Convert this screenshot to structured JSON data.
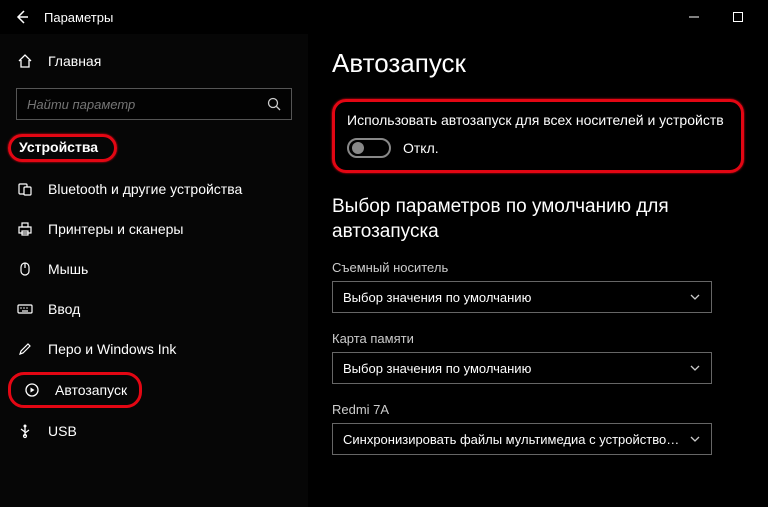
{
  "window": {
    "title": "Параметры"
  },
  "sidebar": {
    "home_label": "Главная",
    "search_placeholder": "Найти параметр",
    "section_header": "Устройства",
    "items": [
      {
        "label": "Bluetooth и другие устройства"
      },
      {
        "label": "Принтеры и сканеры"
      },
      {
        "label": "Мышь"
      },
      {
        "label": "Ввод"
      },
      {
        "label": "Перо и Windows Ink"
      },
      {
        "label": "Автозапуск"
      },
      {
        "label": "USB"
      }
    ]
  },
  "page": {
    "title": "Автозапуск",
    "toggle_label": "Использовать автозапуск для всех носителей и устройств",
    "toggle_state": "Откл.",
    "subhead": "Выбор параметров по умолчанию для автозапуска",
    "fields": [
      {
        "label": "Съемный носитель",
        "value": "Выбор значения по умолчанию"
      },
      {
        "label": "Карта памяти",
        "value": "Выбор значения по умолчанию"
      },
      {
        "label": "Redmi 7A",
        "value": "Синхронизировать файлы мультимедиа с устройством (П..."
      }
    ]
  }
}
